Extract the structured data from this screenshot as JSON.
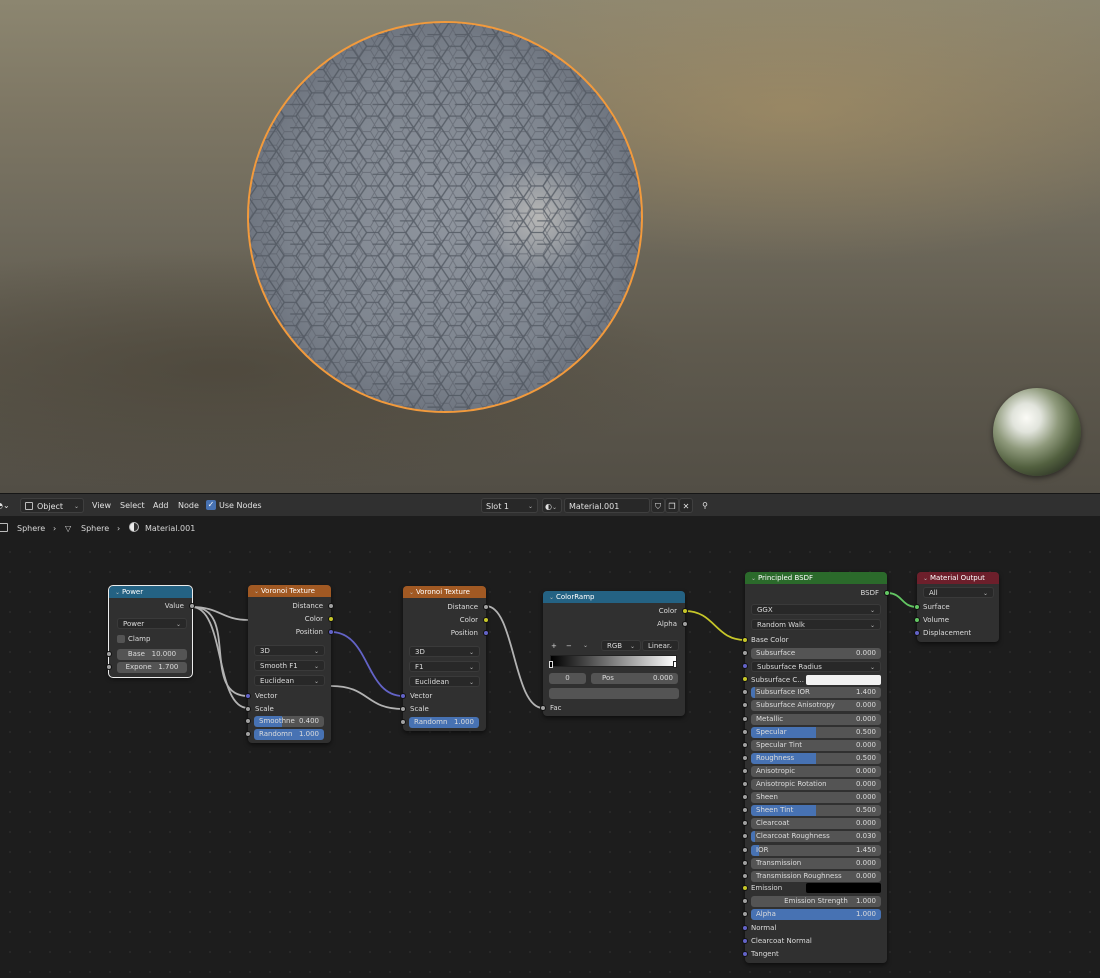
{
  "colors": {
    "selection_outline": "#f29a3c",
    "header_math": "#246283",
    "header_texture": "#a15923",
    "header_converter": "#246283",
    "header_shader": "#2b6a2b",
    "header_output": "#6d1f2b",
    "slider": "#4772b3"
  },
  "header": {
    "mode_label": "Object",
    "menu": [
      "View",
      "Select",
      "Add",
      "Node"
    ],
    "use_nodes_label": "Use Nodes",
    "use_nodes_checked": true,
    "slot_label": "Slot 1",
    "material_name": "Material.001"
  },
  "breadcrumb": {
    "object": "Sphere",
    "mesh": "Sphere",
    "material": "Material.001"
  },
  "nodes": {
    "power": {
      "title": "Power",
      "out_value": "Value",
      "operation": "Power",
      "clamp": "Clamp",
      "base_label": "Base",
      "base_value": "10.000",
      "exponent_label": "Expone",
      "exponent_value": "1.700"
    },
    "voronoi1": {
      "title": "Voronoi Texture",
      "out_distance": "Distance",
      "out_color": "Color",
      "out_position": "Position",
      "dimensions": "3D",
      "feature": "Smooth F1",
      "metric": "Euclidean",
      "in_vector": "Vector",
      "in_scale": "Scale",
      "smooth_label": "Smoothne",
      "smooth_value": "0.400",
      "random_label": "Randomn",
      "random_value": "1.000"
    },
    "voronoi2": {
      "title": "Voronoi Texture",
      "out_distance": "Distance",
      "out_color": "Color",
      "out_position": "Position",
      "dimensions": "3D",
      "feature": "F1",
      "metric": "Euclidean",
      "in_vector": "Vector",
      "in_scale": "Scale",
      "random_label": "Randomn",
      "random_value": "1.000"
    },
    "colorramp": {
      "title": "ColorRamp",
      "out_color": "Color",
      "out_alpha": "Alpha",
      "add_btn": "+",
      "remove_btn": "−",
      "color_mode": "RGB",
      "interpolation": "Linear",
      "index": "0",
      "pos_label": "Pos",
      "pos_value": "0.000",
      "in_fac": "Fac"
    },
    "bsdf": {
      "title": "Principled BSDF",
      "out_bsdf": "BSDF",
      "distribution": "GGX",
      "subsurface_method": "Random Walk",
      "base_color": "Base Color",
      "params": [
        {
          "label": "Subsurface",
          "value": "0.000",
          "fill": 0
        },
        {
          "label": "Subsurface Radius",
          "value": "",
          "fill": 0
        },
        {
          "label": "Subsurface C...",
          "value": "",
          "fill": 0
        },
        {
          "label": "Subsurface IOR",
          "value": "1.400",
          "fill": 0.03
        },
        {
          "label": "Subsurface Anisotropy",
          "value": "0.000",
          "fill": 0
        },
        {
          "label": "Metallic",
          "value": "0.000",
          "fill": 0
        },
        {
          "label": "Specular",
          "value": "0.500",
          "fill": 0.5
        },
        {
          "label": "Specular Tint",
          "value": "0.000",
          "fill": 0
        },
        {
          "label": "Roughness",
          "value": "0.500",
          "fill": 0.5
        },
        {
          "label": "Anisotropic",
          "value": "0.000",
          "fill": 0
        },
        {
          "label": "Anisotropic Rotation",
          "value": "0.000",
          "fill": 0
        },
        {
          "label": "Sheen",
          "value": "0.000",
          "fill": 0
        },
        {
          "label": "Sheen Tint",
          "value": "0.500",
          "fill": 0.5
        },
        {
          "label": "Clearcoat",
          "value": "0.000",
          "fill": 0
        },
        {
          "label": "Clearcoat Roughness",
          "value": "0.030",
          "fill": 0.03
        },
        {
          "label": "IOR",
          "value": "1.450",
          "fill": 0.06
        },
        {
          "label": "Transmission",
          "value": "0.000",
          "fill": 0
        },
        {
          "label": "Transmission Roughness",
          "value": "0.000",
          "fill": 0
        }
      ],
      "emission": "Emission",
      "emission_strength_label": "Emission Strength",
      "emission_strength_value": "1.000",
      "alpha_label": "Alpha",
      "alpha_value": "1.000",
      "normal": "Normal",
      "clearcoat_normal": "Clearcoat Normal",
      "tangent": "Tangent"
    },
    "output": {
      "title": "Material Output",
      "target": "All",
      "in_surface": "Surface",
      "in_volume": "Volume",
      "in_displacement": "Displacement"
    }
  }
}
